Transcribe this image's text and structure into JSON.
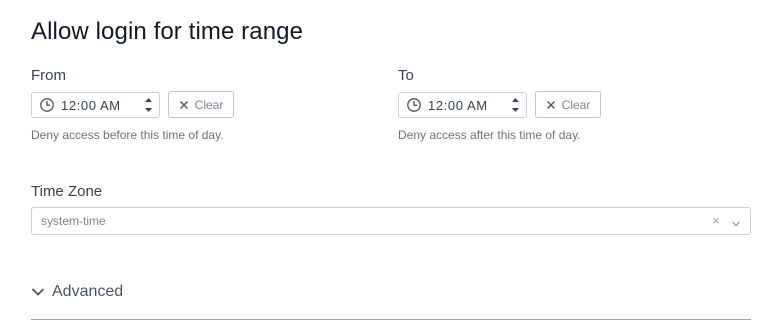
{
  "title": "Allow login for time range",
  "from": {
    "label": "From",
    "time": "12:00 AM",
    "clear_label": "Clear",
    "help": "Deny access before this time of day."
  },
  "to": {
    "label": "To",
    "time": "12:00 AM",
    "clear_label": "Clear",
    "help": "Deny access after this time of day."
  },
  "timezone": {
    "label": "Time Zone",
    "value": "system-time",
    "clear_glyph": "×"
  },
  "advanced": {
    "label": "Advanced"
  },
  "icons": {
    "clock": "clock-icon",
    "spinner": "spinner-arrows-icon",
    "clear": "close-icon",
    "caret": "chevron-down-icon"
  },
  "colors": {
    "border": "#c9ced6",
    "muted_text": "#6b7280",
    "divider": "#9ca3af"
  }
}
